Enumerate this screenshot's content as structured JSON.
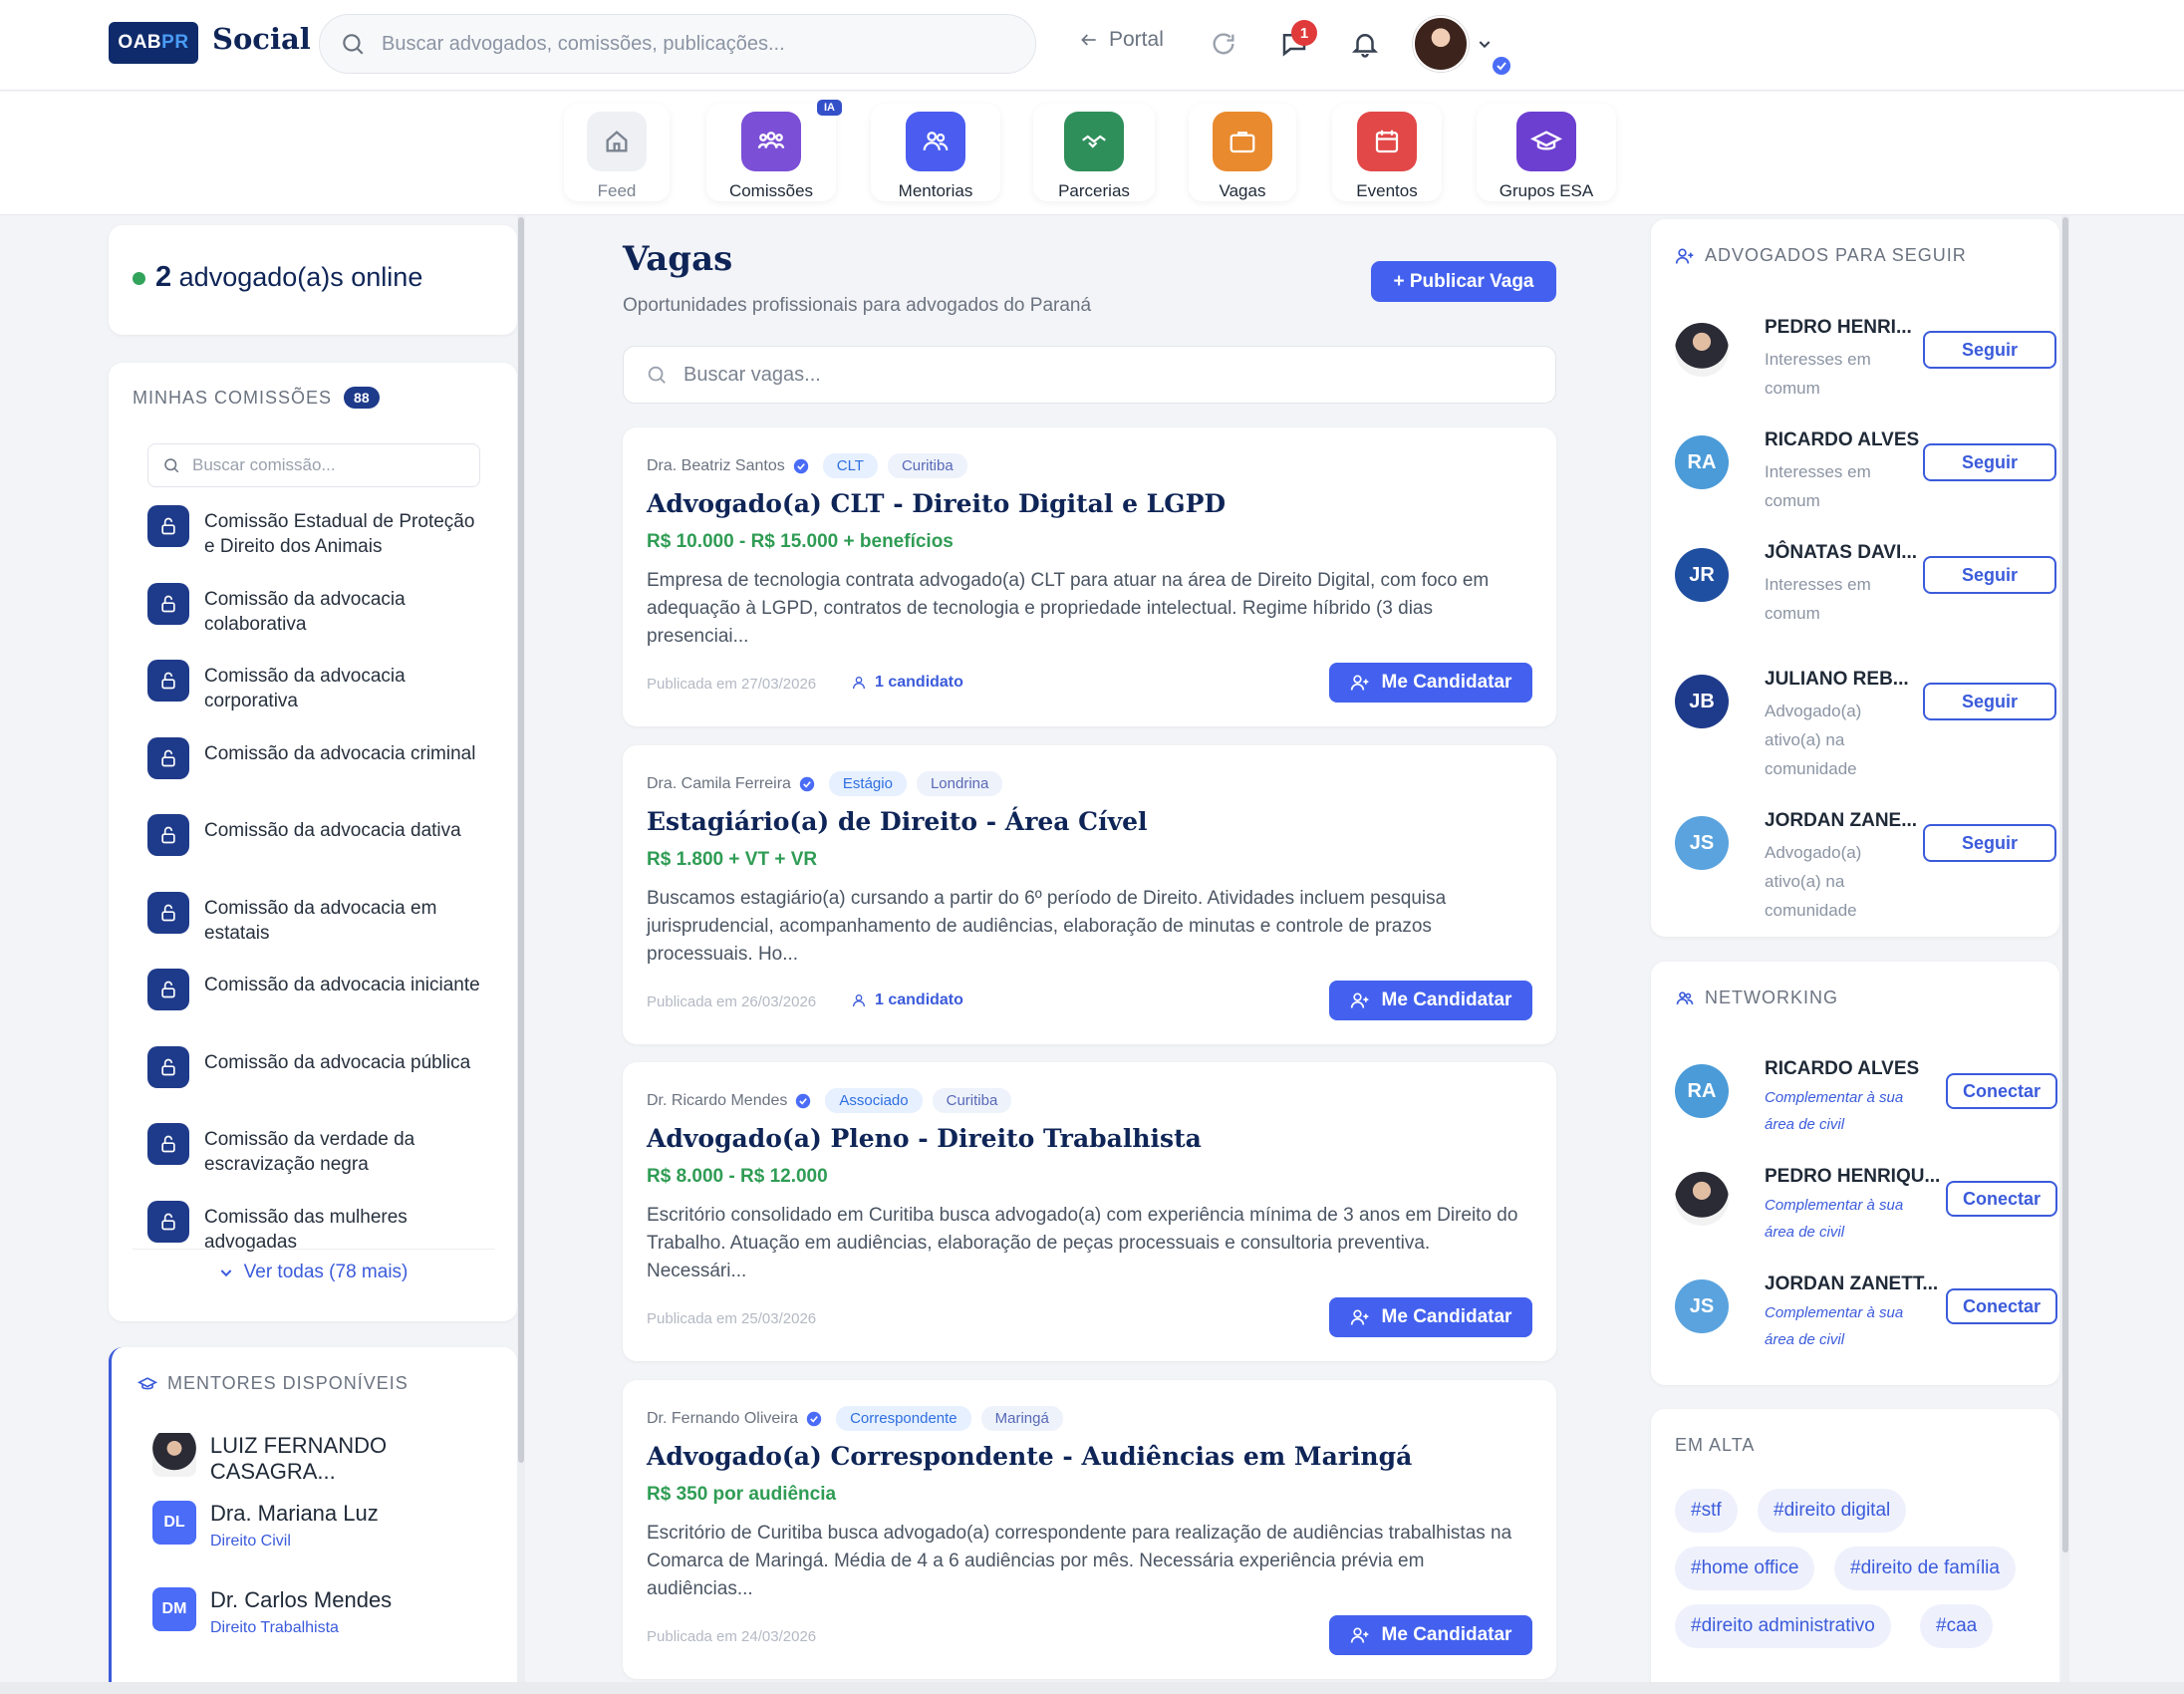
{
  "header": {
    "logo_left": "OAB",
    "logo_right": "PR",
    "brand": "Social",
    "search_placeholder": "Buscar advogados, comissões, publicações...",
    "portal_label": "Portal",
    "notification_count": "1"
  },
  "nav": [
    {
      "label": "Feed",
      "icon": "home-icon",
      "color": "#eef0f4"
    },
    {
      "label": "Comissões",
      "icon": "users-group-icon",
      "color": "#7b4fd6",
      "badge": "IA"
    },
    {
      "label": "Mentorias",
      "icon": "users-icon",
      "color": "#4a5df0"
    },
    {
      "label": "Parcerias",
      "icon": "handshake-icon",
      "color": "#2f8f5b"
    },
    {
      "label": "Vagas",
      "icon": "briefcase-icon",
      "color": "#e98a2e"
    },
    {
      "label": "Eventos",
      "icon": "calendar-icon",
      "color": "#e24848"
    },
    {
      "label": "Grupos ESA",
      "icon": "graduation-cap-icon",
      "color": "#6d3fd0"
    }
  ],
  "online": {
    "count": "2",
    "label": "advogado(a)s online"
  },
  "commissions": {
    "title": "MINHAS COMISSÕES",
    "count": "88",
    "search_placeholder": "Buscar comissão...",
    "items": [
      "Comissão Estadual de Proteção e Direito dos Animais",
      "Comissão da advocacia colaborativa",
      "Comissão da advocacia corporativa",
      "Comissão da advocacia criminal",
      "Comissão da advocacia dativa",
      "Comissão da advocacia em estatais",
      "Comissão da advocacia iniciante",
      "Comissão da advocacia pública",
      "Comissão da verdade da escravização negra",
      "Comissão das mulheres advogadas"
    ],
    "see_all": "Ver todas (78 mais)"
  },
  "mentors": {
    "title": "MENTORES DISPONÍVEIS",
    "items": [
      {
        "name": "LUIZ FERNANDO CASAGRA...",
        "initials": "",
        "spec": ""
      },
      {
        "name": "Dra. Mariana Luz",
        "initials": "DL",
        "spec": "Direito Civil"
      },
      {
        "name": "Dr. Carlos Mendes",
        "initials": "DM",
        "spec": "Direito Trabalhista"
      }
    ]
  },
  "main": {
    "title": "Vagas",
    "subtitle": "Oportunidades profissionais para advogados do Paraná",
    "publish_label": "+ Publicar Vaga",
    "search_placeholder": "Buscar vagas...",
    "apply_label": "Me Candidatar",
    "jobs": [
      {
        "author": "Dra. Beatriz Santos",
        "type": "CLT",
        "city": "Curitiba",
        "title": "Advogado(a) CLT - Direito Digital e LGPD",
        "salary": "R$ 10.000 - R$ 15.000 + benefícios",
        "description": "Empresa de tecnologia contrata advogado(a) CLT para atuar na área de Direito Digital, com foco em adequação à LGPD, contratos de tecnologia e propriedade intelectual. Regime híbrido (3 dias presenciai...",
        "date": "Publicada em 27/03/2026",
        "candidates": "1 candidato"
      },
      {
        "author": "Dra. Camila Ferreira",
        "type": "Estágio",
        "city": "Londrina",
        "title": "Estagiário(a) de Direito - Área Cível",
        "salary": "R$ 1.800 + VT + VR",
        "description": "Buscamos estagiário(a) cursando a partir do 6º período de Direito. Atividades incluem pesquisa jurisprudencial, acompanhamento de audiências, elaboração de minutas e controle de prazos processuais. Ho...",
        "date": "Publicada em 26/03/2026",
        "candidates": "1 candidato"
      },
      {
        "author": "Dr. Ricardo Mendes",
        "type": "Associado",
        "city": "Curitiba",
        "title": "Advogado(a) Pleno - Direito Trabalhista",
        "salary": "R$ 8.000 - R$ 12.000",
        "description": "Escritório consolidado em Curitiba busca advogado(a) com experiência mínima de 3 anos em Direito do Trabalho. Atuação em audiências, elaboração de peças processuais e consultoria preventiva. Necessári...",
        "date": "Publicada em 25/03/2026",
        "candidates": ""
      },
      {
        "author": "Dr. Fernando Oliveira",
        "type": "Correspondente",
        "city": "Maringá",
        "title": "Advogado(a) Correspondente - Audiências em Maringá",
        "salary": "R$ 350 por audiência",
        "description": "Escritório de Curitiba busca advogado(a) correspondente para realização de audiências trabalhistas na Comarca de Maringá. Média de 4 a 6 audiências por mês. Necessária experiência prévia em audiências...",
        "date": "Publicada em 24/03/2026",
        "candidates": ""
      }
    ]
  },
  "follow": {
    "title": "ADVOGADOS PARA SEGUIR",
    "button": "Seguir",
    "items": [
      {
        "name": "PEDRO HENRI...",
        "initials": "",
        "sub": "Interesses em comum"
      },
      {
        "name": "RICARDO ALVES",
        "initials": "RA",
        "sub": "Interesses em comum"
      },
      {
        "name": "JÔNATAS DAVI...",
        "initials": "JR",
        "sub": "Interesses em comum"
      },
      {
        "name": "JULIANO REB...",
        "initials": "JB",
        "sub": "Advogado(a) ativo(a) na comunidade"
      },
      {
        "name": "JORDAN ZANE...",
        "initials": "JS",
        "sub": "Advogado(a) ativo(a) na comunidade"
      }
    ]
  },
  "networking": {
    "title": "NETWORKING",
    "button": "Conectar",
    "items": [
      {
        "name": "RICARDO ALVES",
        "initials": "RA",
        "sub": "Complementar à sua área de civil"
      },
      {
        "name": "PEDRO HENRIQU...",
        "initials": "",
        "sub": "Complementar à sua área de civil"
      },
      {
        "name": "JORDAN ZANETT...",
        "initials": "JS",
        "sub": "Complementar à sua área de civil"
      }
    ]
  },
  "trending": {
    "title": "EM ALTA",
    "tags": [
      "#stf",
      "#direito digital",
      "#home office",
      "#direito de família",
      "#direito administrativo",
      "#caa"
    ]
  }
}
